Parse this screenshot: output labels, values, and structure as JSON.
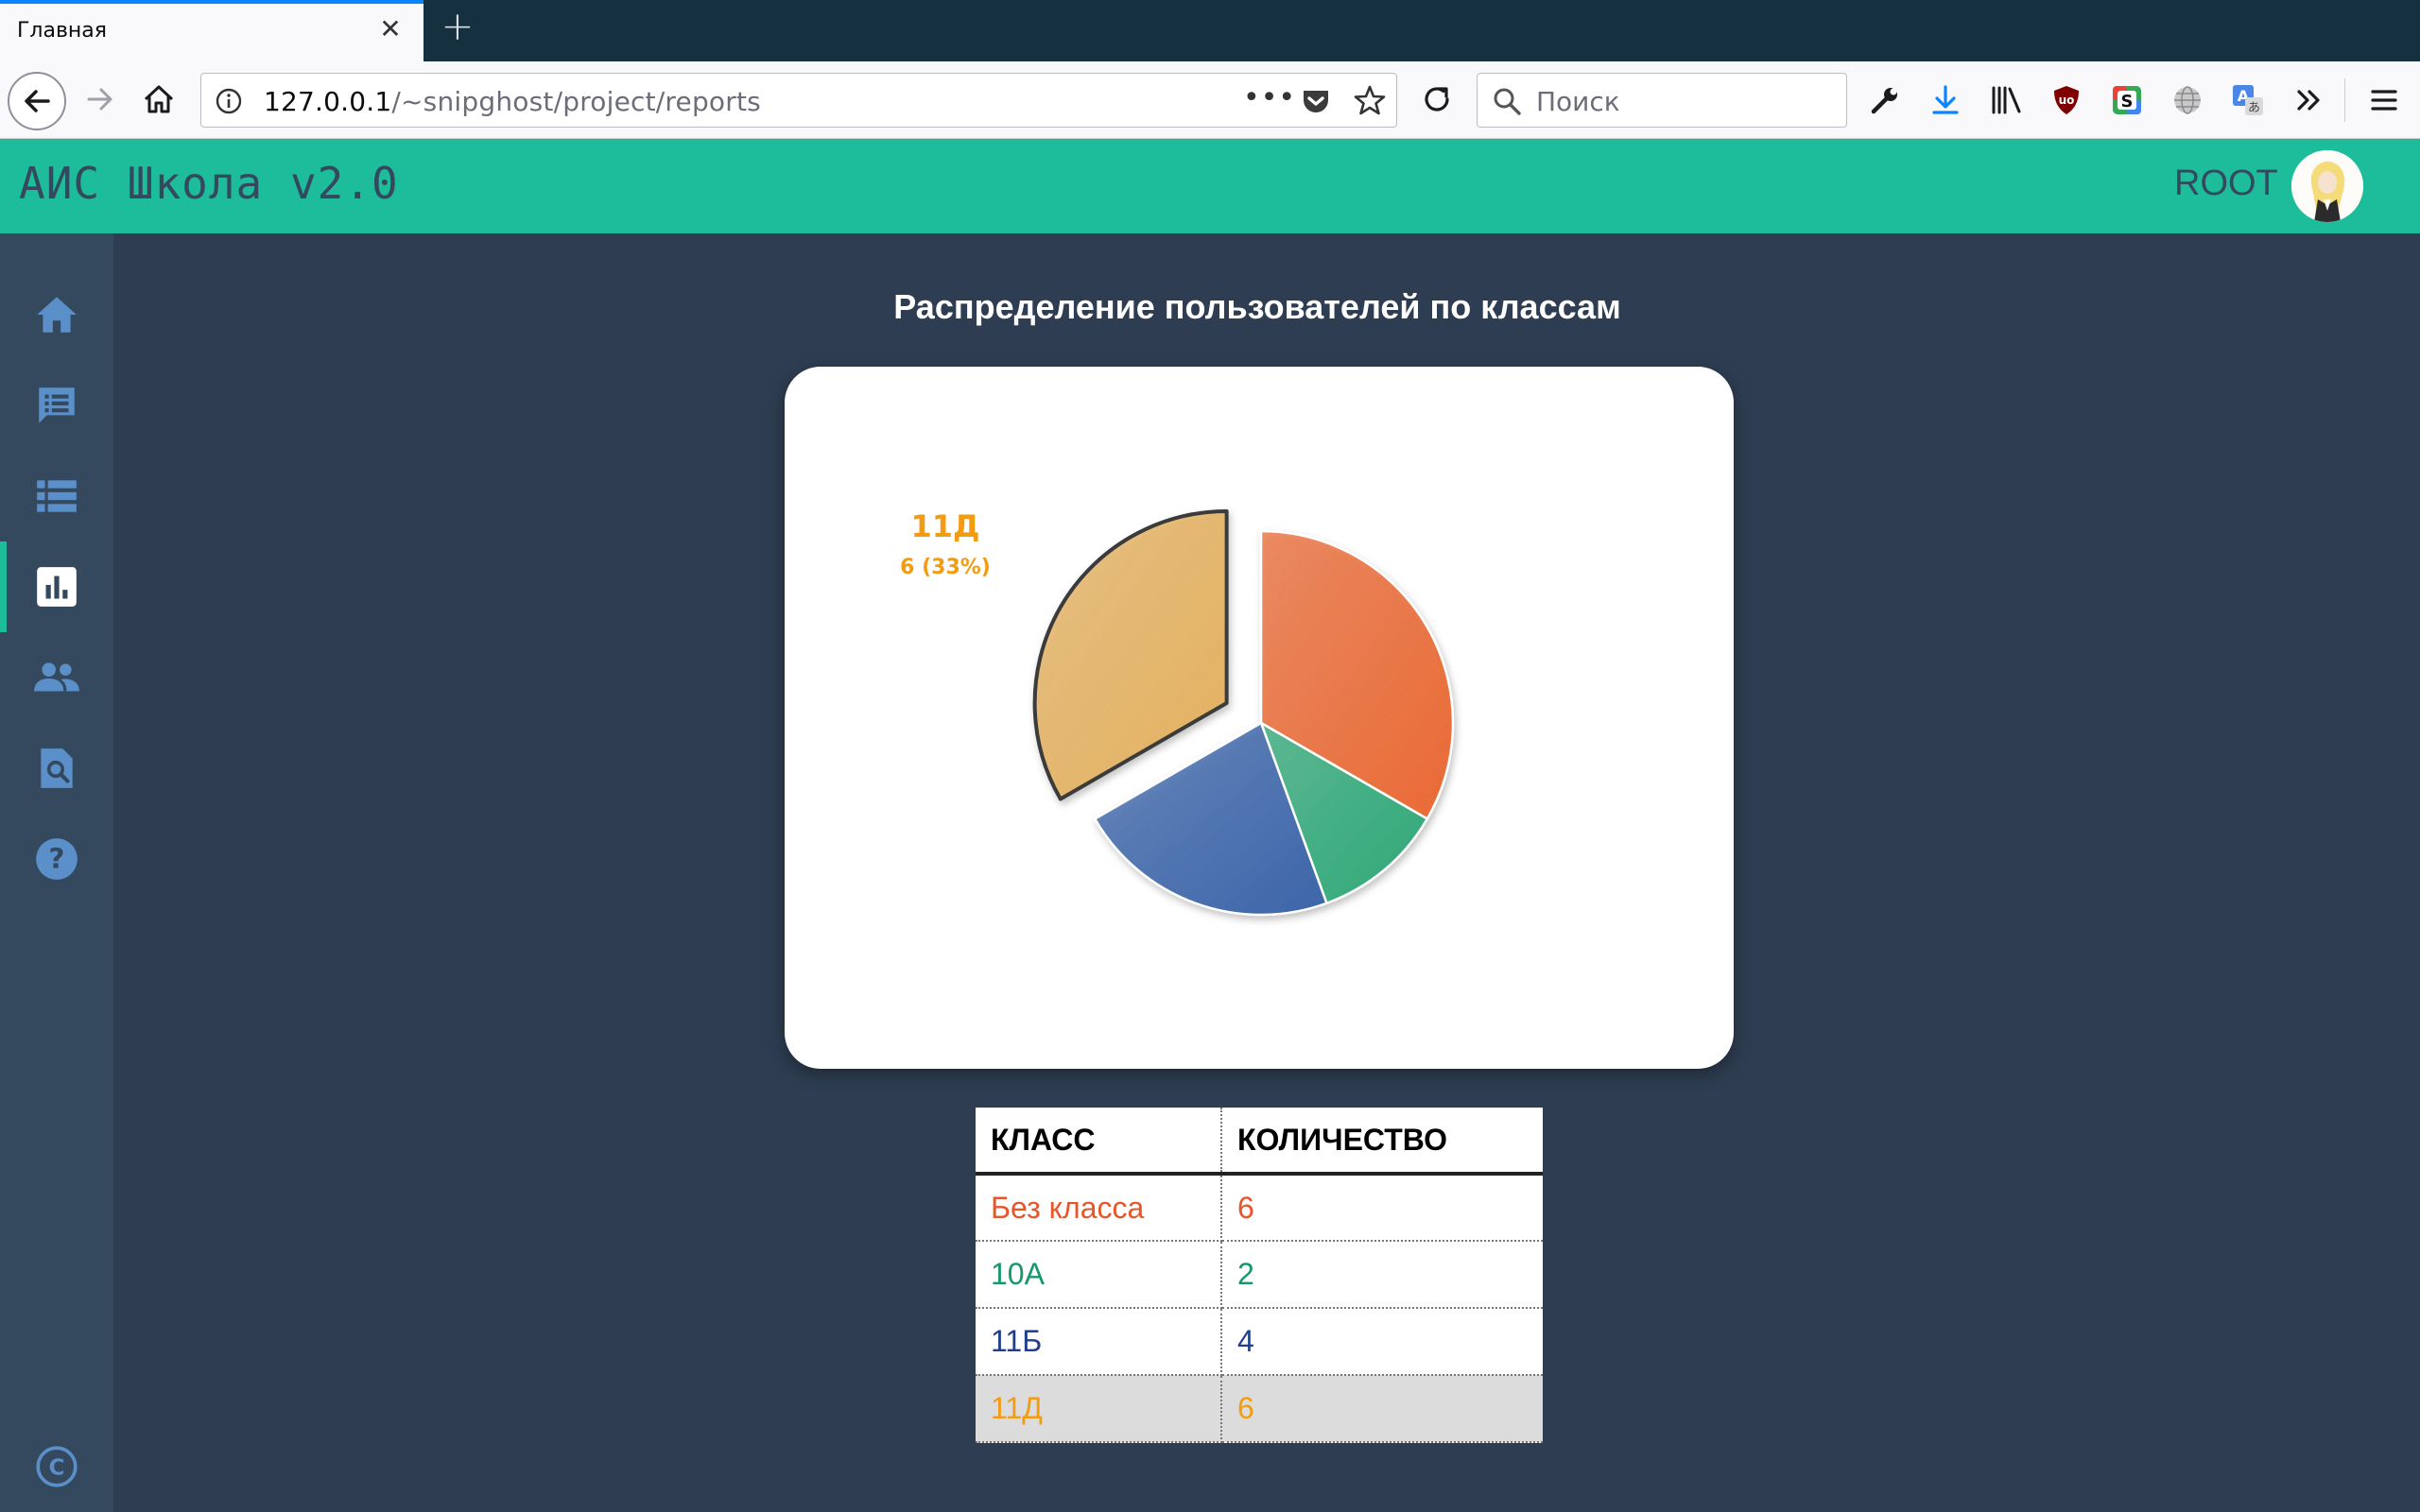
{
  "browser": {
    "tab_title": "Главная",
    "url_host": "127.0.0.1",
    "url_path": "/~snipghost/project/reports",
    "search_placeholder": "Поиск"
  },
  "header": {
    "app_title": "АИС Школа v2.0",
    "user_name": "ROOT"
  },
  "sidebar": {
    "items": [
      {
        "icon": "home-icon"
      },
      {
        "icon": "messages-icon"
      },
      {
        "icon": "list-icon"
      },
      {
        "icon": "reports-chart-icon",
        "active": true
      },
      {
        "icon": "users-icon"
      },
      {
        "icon": "search-document-icon"
      },
      {
        "icon": "help-icon"
      },
      {
        "icon": "copyright-icon"
      }
    ]
  },
  "report": {
    "title": "Распределение пользователей по классам",
    "table": {
      "headers": [
        "КЛАСС",
        "КОЛИЧЕСТВО"
      ],
      "rows": [
        {
          "class": "Без класса",
          "count": "6",
          "color": "#e8552a"
        },
        {
          "class": "10А",
          "count": "2",
          "color": "#17976a"
        },
        {
          "class": "11Б",
          "count": "4",
          "color": "#1f3f8c"
        },
        {
          "class": "11Д",
          "count": "6",
          "color": "#f39c12",
          "highlighted": true
        }
      ]
    }
  },
  "chart_data": {
    "type": "pie",
    "categories": [
      "Без класса",
      "10А",
      "11Б",
      "11Д"
    ],
    "values": [
      6,
      2,
      4,
      6
    ],
    "colors": [
      "#ea6a35",
      "#2fa877",
      "#3d66aa",
      "#e4b160"
    ],
    "exploded": "11Д",
    "label": {
      "name": "11Д",
      "text": "6 (33%)",
      "color": "#f39c12"
    }
  }
}
